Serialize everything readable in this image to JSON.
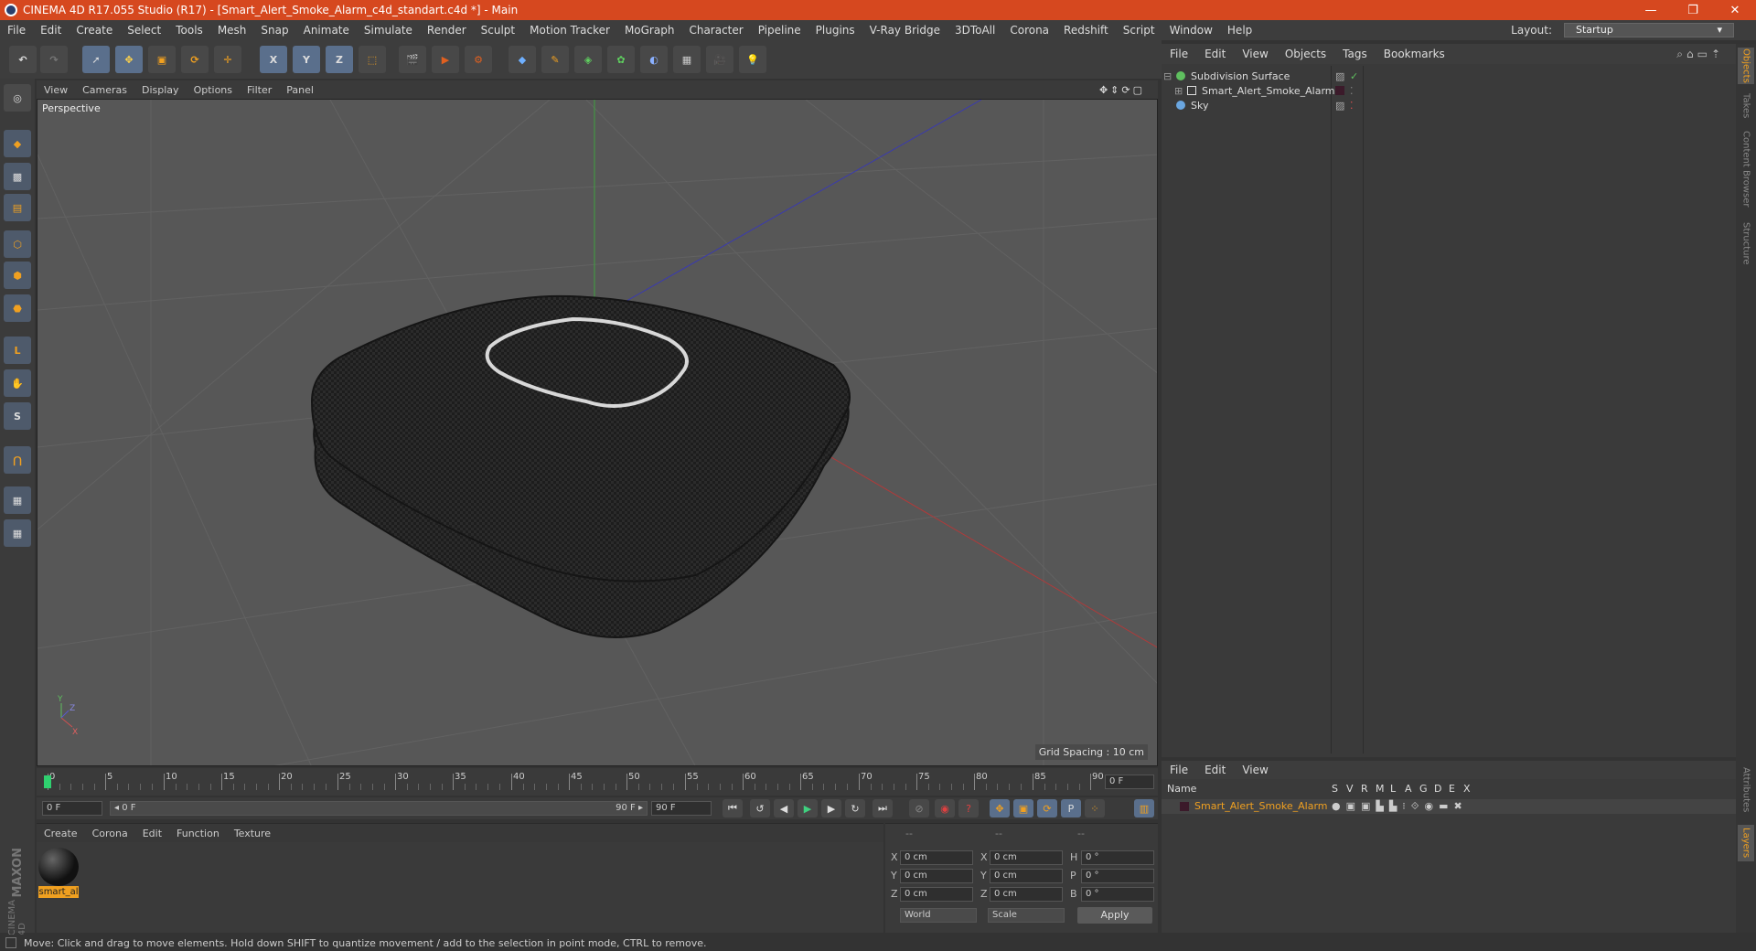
{
  "window": {
    "title": "CINEMA 4D R17.055 Studio (R17) - [Smart_Alert_Smoke_Alarm_c4d_standart.c4d *] - Main",
    "minimize": "—",
    "restore": "❐",
    "close": "✕"
  },
  "menu": [
    "File",
    "Edit",
    "Create",
    "Select",
    "Tools",
    "Mesh",
    "Snap",
    "Animate",
    "Simulate",
    "Render",
    "Sculpt",
    "Motion Tracker",
    "MoGraph",
    "Character",
    "Pipeline",
    "Plugins",
    "V-Ray Bridge",
    "3DToAll",
    "Corona",
    "Redshift",
    "Script",
    "Window",
    "Help"
  ],
  "layout": {
    "label": "Layout:",
    "value": "Startup"
  },
  "toolbar": {
    "axis_x": "X",
    "axis_y": "Y",
    "axis_z": "Z"
  },
  "viewport": {
    "menu": [
      "View",
      "Cameras",
      "Display",
      "Options",
      "Filter",
      "Panel"
    ],
    "label": "Perspective",
    "grid_spacing": "Grid Spacing : 10 cm",
    "axis_y": "Y",
    "axis_z": "Z",
    "axis_x": "X"
  },
  "timeline": {
    "ticks": [
      "0",
      "5",
      "10",
      "15",
      "20",
      "25",
      "30",
      "35",
      "40",
      "45",
      "50",
      "55",
      "60",
      "65",
      "70",
      "75",
      "80",
      "85",
      "90"
    ],
    "current_frame": "0 F",
    "start": "0 F",
    "range_start": "◂ 0 F",
    "range_end": "90 F ▸",
    "end": "90 F"
  },
  "materials": {
    "menu": [
      "Create",
      "Corona",
      "Edit",
      "Function",
      "Texture"
    ],
    "items": [
      {
        "label": "smart_al"
      }
    ]
  },
  "coords": {
    "headers": [
      "--",
      "--",
      "--"
    ],
    "rows": [
      {
        "a": "X",
        "av": "0 cm",
        "b": "X",
        "bv": "0 cm",
        "c": "H",
        "cv": "0 °"
      },
      {
        "a": "Y",
        "av": "0 cm",
        "b": "Y",
        "bv": "0 cm",
        "c": "P",
        "cv": "0 °"
      },
      {
        "a": "Z",
        "av": "0 cm",
        "b": "Z",
        "bv": "0 cm",
        "c": "B",
        "cv": "0 °"
      }
    ],
    "world": "World",
    "scale": "Scale",
    "apply": "Apply"
  },
  "object_manager": {
    "menu": [
      "File",
      "Edit",
      "View",
      "Objects",
      "Tags",
      "Bookmarks"
    ],
    "objects": [
      {
        "name": "Subdivision Surface",
        "color": "#5fbf5f"
      },
      {
        "name": "Smart_Alert_Smoke_Alarm",
        "color": "#cfcfcf"
      },
      {
        "name": "Sky",
        "color": "#6aa6e0"
      }
    ]
  },
  "layer_manager": {
    "menu": [
      "File",
      "Edit",
      "View"
    ],
    "columns": [
      "Name",
      "S",
      "V",
      "R",
      "M",
      "L",
      "A",
      "G",
      "D",
      "E",
      "X"
    ],
    "layers": [
      {
        "name": "Smart_Alert_Smoke_Alarm",
        "color": "#3b1a2a"
      }
    ]
  },
  "side_tabs": [
    "Objects",
    "Takes",
    "Content Browser",
    "Structure",
    "Attributes",
    "Layers"
  ],
  "brand": {
    "line1": "MAXON",
    "line2": "CINEMA 4D"
  },
  "status": "Move: Click and drag to move elements. Hold down SHIFT to quantize movement / add to the selection in point mode, CTRL to remove."
}
